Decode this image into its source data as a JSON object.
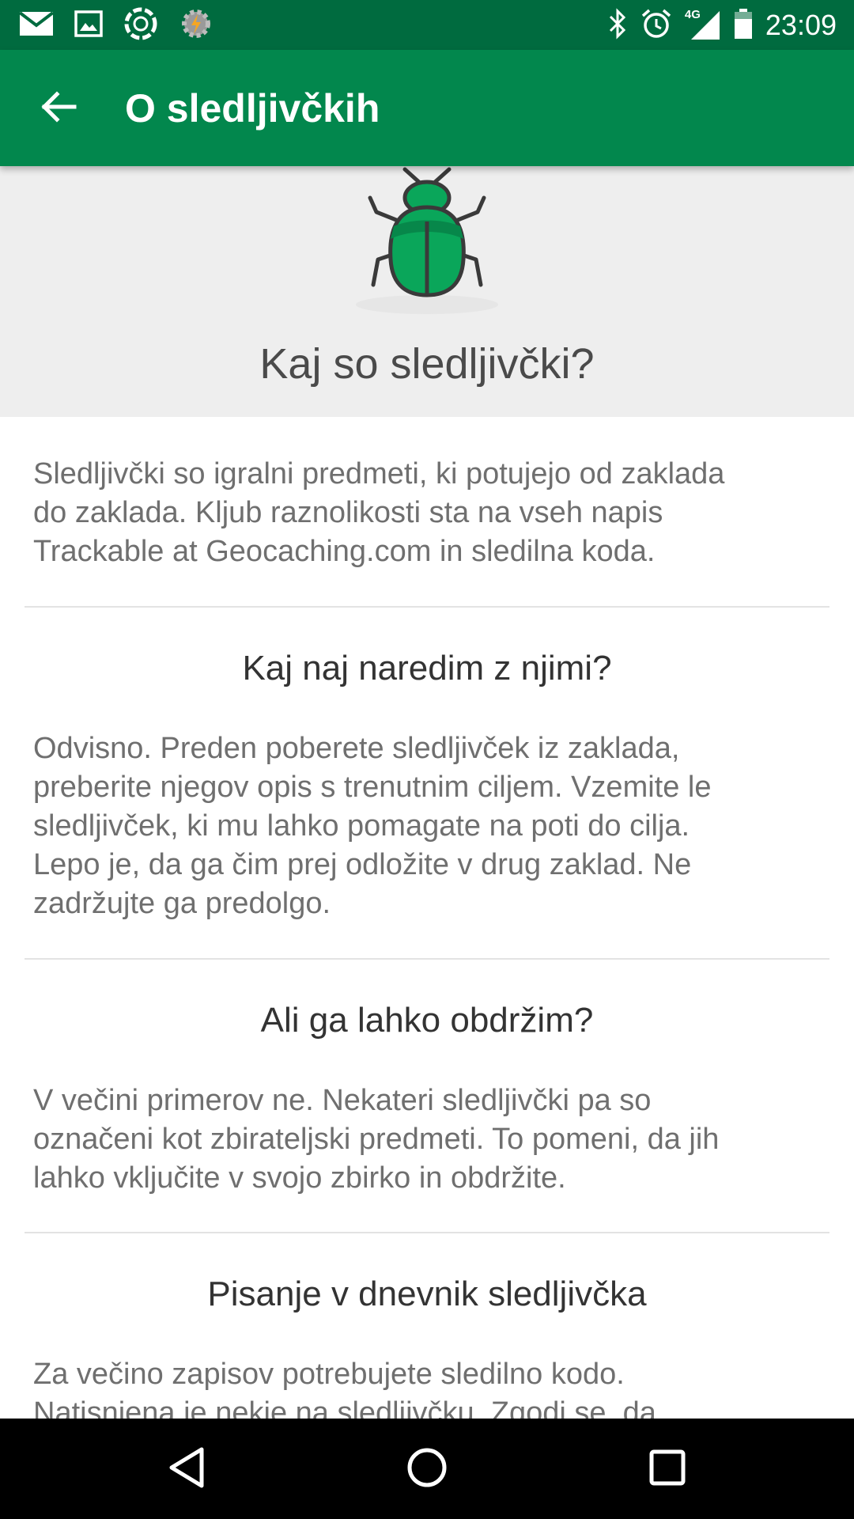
{
  "status_bar": {
    "time": "23:09",
    "network": "4G",
    "left_icons": [
      "mail-icon",
      "image-icon",
      "aperture-icon",
      "settings-gear-icon"
    ],
    "right_icons": [
      "bluetooth-icon",
      "alarm-icon",
      "signal-icon",
      "battery-icon"
    ]
  },
  "app_bar": {
    "title": "O sledljivčkih",
    "back_icon": "arrow-back-icon"
  },
  "hero": {
    "icon": "bug-icon",
    "title": "Kaj so sledljivčki?"
  },
  "sections": [
    {
      "heading": "",
      "body": [
        "Sledljivčki so igralni predmeti, ki potujejo od zaklada",
        "do zaklada. Kljub raznolikosti sta na vseh napis",
        "Trackable at Geocaching.com in sledilna koda."
      ]
    },
    {
      "heading": "Kaj naj naredim z njimi?",
      "body": [
        "Odvisno. Preden poberete sledljivček iz zaklada,",
        "preberite njegov opis s trenutnim ciljem. Vzemite le",
        "sledljivček, ki mu lahko pomagate na poti do cilja.",
        "Lepo je, da ga čim prej odložite v drug zaklad. Ne",
        "zadržujte ga predolgo."
      ]
    },
    {
      "heading": "Ali ga lahko obdržim?",
      "body": [
        "V večini primerov ne. Nekateri sledljivčki pa so",
        "označeni kot zbirateljski predmeti. To pomeni, da jih",
        "lahko vključite v svojo zbirko in obdržite."
      ]
    },
    {
      "heading": "Pisanje v dnevnik sledljivčka",
      "body": [
        "Za večino zapisov potrebujete sledilno kodo.",
        "Natisnjena je nekje na sledljivčku. Zgodi se, da"
      ]
    }
  ],
  "colors": {
    "status_bar": "#006b3f",
    "app_bar": "#02874d",
    "bug_green": "#0aa65a",
    "bug_dark": "#07874a"
  },
  "nav_bar": {
    "icons": [
      "back-triangle-icon",
      "home-circle-icon",
      "recents-square-icon"
    ]
  }
}
